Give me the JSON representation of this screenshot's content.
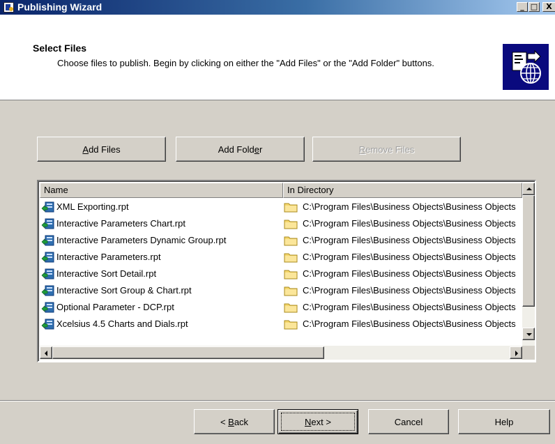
{
  "window": {
    "title": "Publishing Wizard",
    "controls": {
      "minimize": "_",
      "maximize": "□",
      "close": "X"
    }
  },
  "header": {
    "title": "Select Files",
    "description": "Choose files to publish.  Begin by clicking on either the \"Add Files\" or the \"Add Folder\" buttons."
  },
  "actions": {
    "add_files": {
      "label": "Add Files"
    },
    "add_folder": {
      "label": "Add Folder"
    },
    "remove_files": {
      "label": "Remove Files",
      "disabled": true
    }
  },
  "file_list": {
    "columns": [
      "Name",
      "In Directory"
    ],
    "rows": [
      {
        "name": "XML Exporting.rpt",
        "directory": "C:\\Program Files\\Business Objects\\Business Objects"
      },
      {
        "name": "Interactive Parameters Chart.rpt",
        "directory": "C:\\Program Files\\Business Objects\\Business Objects"
      },
      {
        "name": "Interactive Parameters Dynamic Group.rpt",
        "directory": "C:\\Program Files\\Business Objects\\Business Objects"
      },
      {
        "name": "Interactive Parameters.rpt",
        "directory": "C:\\Program Files\\Business Objects\\Business Objects"
      },
      {
        "name": "Interactive Sort Detail.rpt",
        "directory": "C:\\Program Files\\Business Objects\\Business Objects"
      },
      {
        "name": "Interactive Sort Group & Chart.rpt",
        "directory": "C:\\Program Files\\Business Objects\\Business Objects"
      },
      {
        "name": "Optional Parameter - DCP.rpt",
        "directory": "C:\\Program Files\\Business Objects\\Business Objects"
      },
      {
        "name": "Xcelsius 4.5 Charts and Dials.rpt",
        "directory": "C:\\Program Files\\Business Objects\\Business Objects"
      }
    ]
  },
  "footer": {
    "back": {
      "label": "< Back"
    },
    "next": {
      "label": "Next >"
    },
    "cancel": {
      "label": "Cancel"
    },
    "help": {
      "label": "Help"
    }
  },
  "colors": {
    "face": "#d4d0c8",
    "title_start": "#0a246a",
    "title_end": "#a6caf0",
    "logo_bg": "#0a0a7e",
    "disabled_text": "#a0a0a0"
  }
}
